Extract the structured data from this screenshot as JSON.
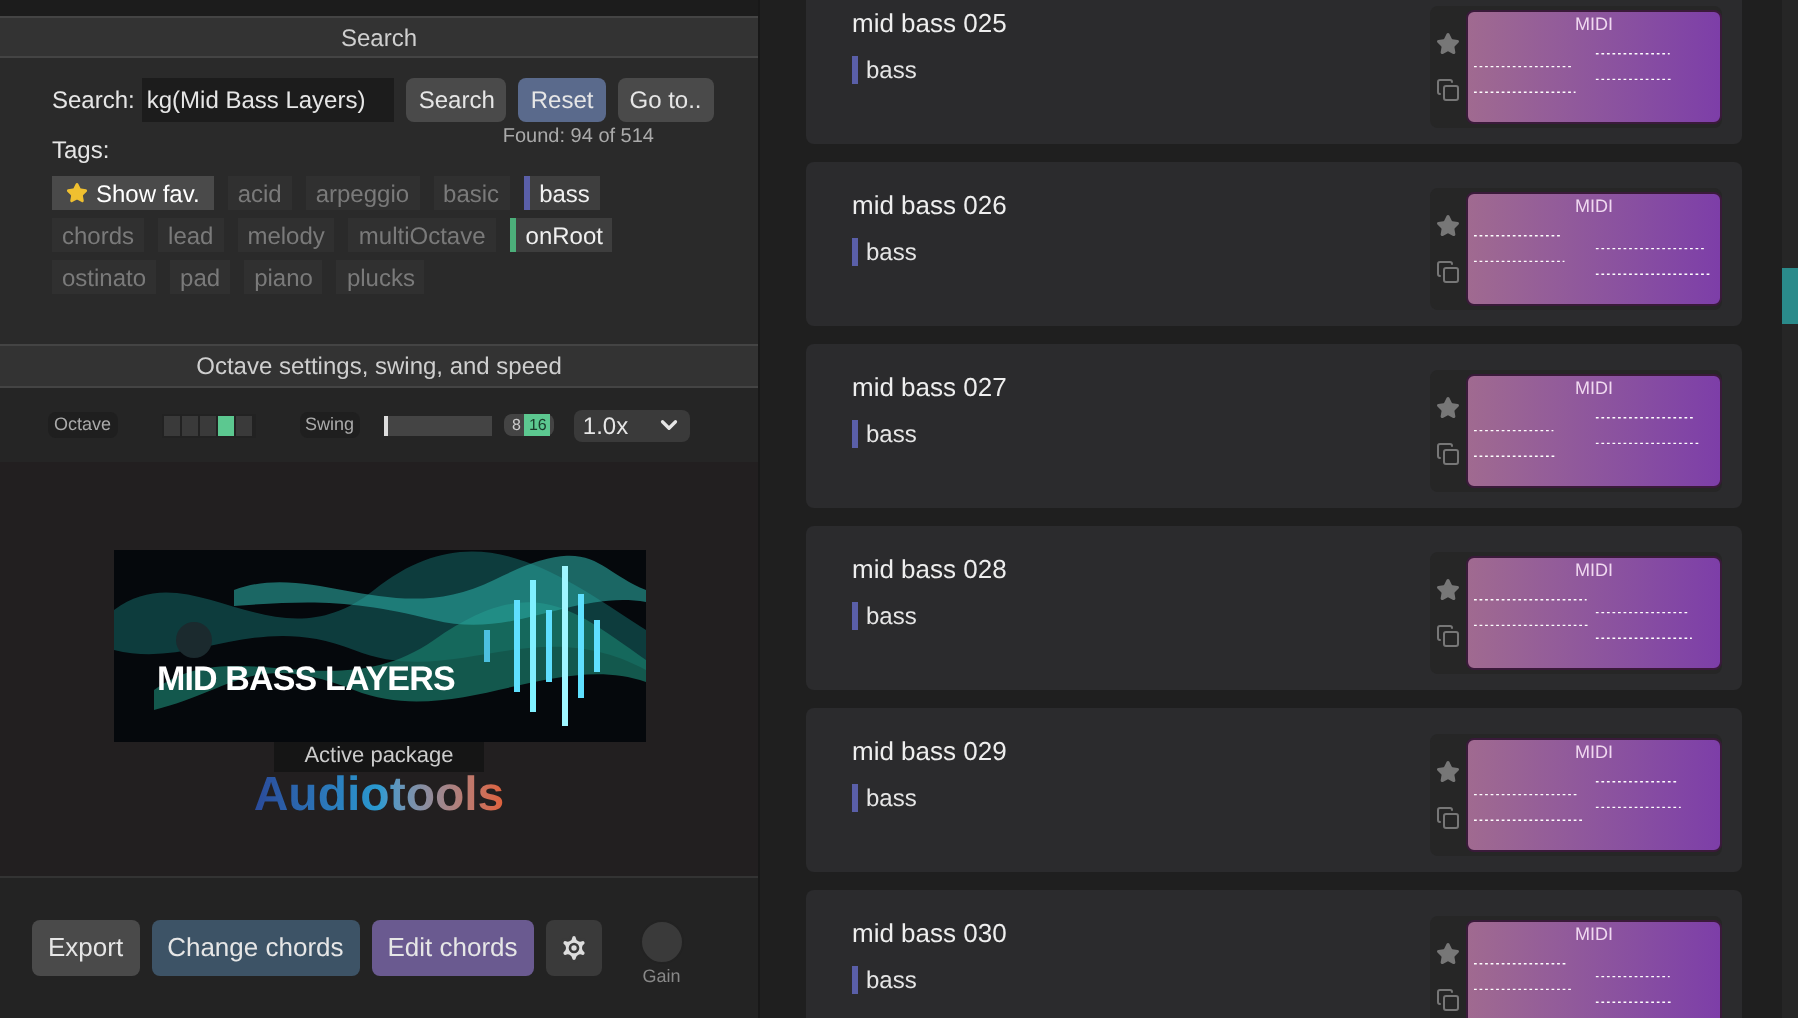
{
  "search_panel": {
    "title": "Search",
    "label": "Search:",
    "value": "kg(Mid Bass Layers)",
    "buttons": [
      {
        "label": "Search",
        "kind": "plain"
      },
      {
        "label": "Reset",
        "kind": "primary"
      },
      {
        "label": "Go to..",
        "kind": "plain"
      }
    ],
    "found": "Found: 94 of 514",
    "tags_label": "Tags:",
    "show_fav": {
      "label": "Show fav.",
      "selected": true
    },
    "tags": [
      {
        "label": "acid",
        "selected": false
      },
      {
        "label": "arpeggio",
        "selected": false
      },
      {
        "label": "basic",
        "selected": false
      },
      {
        "label": "bass",
        "selected": true,
        "color": "#5a5fa8"
      },
      {
        "label": "chords",
        "selected": false
      },
      {
        "label": "lead",
        "selected": false
      },
      {
        "label": "melody",
        "selected": false
      },
      {
        "label": "multiOctave",
        "selected": false
      },
      {
        "label": "onRoot",
        "selected": true,
        "color": "#4caf7a"
      },
      {
        "label": "ostinato",
        "selected": false
      },
      {
        "label": "pad",
        "selected": false
      },
      {
        "label": "piano",
        "selected": false
      },
      {
        "label": "plucks",
        "selected": false
      }
    ]
  },
  "settings_panel": {
    "title": "Octave settings, swing, and speed",
    "octave_label": "Octave",
    "octave_cells": [
      {
        "selected": false
      },
      {
        "selected": false
      },
      {
        "selected": false
      },
      {
        "selected": true
      },
      {
        "selected": false
      }
    ],
    "swing_label": "Swing",
    "swing": {
      "level": 0.02
    },
    "grid_options": [
      {
        "label": "8",
        "selected": false
      },
      {
        "label": "16",
        "selected": true
      }
    ],
    "speed": "1.0x"
  },
  "package": {
    "title": "MID BASS LAYERS",
    "caption": "Active package",
    "brand": "Audiotools"
  },
  "footer": {
    "buttons": [
      {
        "label": "Export",
        "kind": "plain"
      },
      {
        "label": "Change chords",
        "kind": "change"
      },
      {
        "label": "Edit chords",
        "kind": "edit"
      }
    ],
    "gain_label": "Gain"
  },
  "patterns": [
    {
      "name": "mid bass 025",
      "tag": "bass",
      "badge": "MIDI"
    },
    {
      "name": "mid bass 026",
      "tag": "bass",
      "badge": "MIDI"
    },
    {
      "name": "mid bass 027",
      "tag": "bass",
      "badge": "MIDI"
    },
    {
      "name": "mid bass 028",
      "tag": "bass",
      "badge": "MIDI"
    },
    {
      "name": "mid bass 029",
      "tag": "bass",
      "badge": "MIDI"
    },
    {
      "name": "mid bass 030",
      "tag": "bass",
      "badge": "MIDI"
    }
  ]
}
